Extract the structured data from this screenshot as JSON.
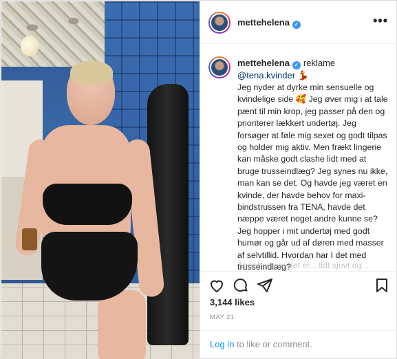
{
  "header": {
    "username": "mettehelena",
    "more_label": "•••"
  },
  "caption": {
    "username": "mettehelena",
    "tag": "reklame",
    "mention": "@tena.kvinder",
    "mention_emoji": "💃",
    "text": "Jeg nyder at dyrke min sensuelle og kvindelige side 🥰 Jeg øver mig i at tale pænt til min krop, jeg passer på den og prioriterer lækkert undertøj. Jeg forsøger at føle mig sexet og godt tilpas og holder mig aktiv. Men frækt lingerie kan måske godt clashe lidt med at bruge trusseindlæg? Jeg synes nu ikke, man kan se det. Og havde jeg været en kvinde, der havde behov for maxi-bindstrussen fra TENA, havde det næppe været noget andre kunne se? Jeg hopper i mit undertøj med godt humør og går ud af døren med masser af selvtillid. Hvordan har I det med trusseindlæg?",
    "truncated_line": "Åbenhed om det er... lidt sjovt og..."
  },
  "actions": {
    "like_icon": "heart-icon",
    "comment_icon": "comment-icon",
    "share_icon": "paper-plane-icon",
    "save_icon": "bookmark-icon"
  },
  "stats": {
    "likes": "3,144 likes",
    "date": "MAY 21"
  },
  "footer": {
    "login_link": "Log in",
    "login_rest": " to like or comment."
  },
  "colors": {
    "link": "#0095f6",
    "mention": "#00376b",
    "verified": "#3897f0"
  }
}
